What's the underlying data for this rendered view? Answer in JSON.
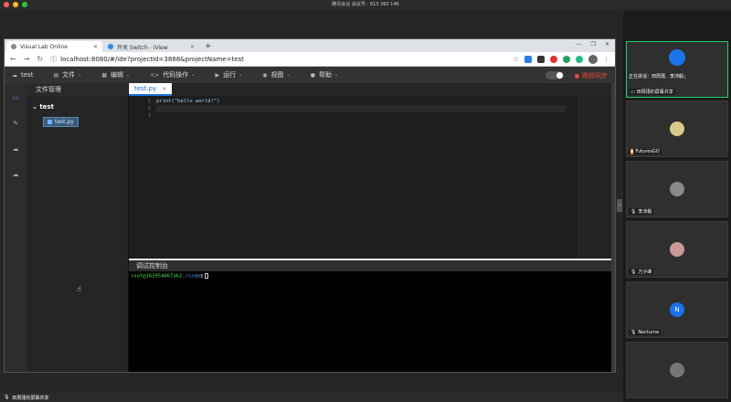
{
  "meeting": {
    "title": "腾讯会议 会议号：813 360 146",
    "screen_share_label": "田周瑾的屏幕共享",
    "speaking_label": "正在讲话：田周瑾、李沛毅；"
  },
  "browser": {
    "tabs": [
      {
        "label": "Visual Lab Online",
        "active": true
      },
      {
        "label": "开关 Switch - iView",
        "active": false
      }
    ],
    "url": "localhost:8080/#/ide?projectId=3888&projectName=test"
  },
  "app": {
    "menu": [
      {
        "label": "test",
        "icon": "cloud-icon"
      },
      {
        "label": "文件",
        "icon": "file-icon"
      },
      {
        "label": "编辑",
        "icon": "edit-icon"
      },
      {
        "label": "代码操作",
        "icon": "code-icon"
      },
      {
        "label": "运行",
        "icon": "play-icon"
      },
      {
        "label": "视图",
        "icon": "view-icon"
      },
      {
        "label": "帮助",
        "icon": "help-icon"
      }
    ],
    "record_status": "跟踪同步",
    "file_panel_title": "文件管理",
    "tree_root": "test",
    "tree_file": "test.py",
    "editor_tab": "test.py",
    "code_lines": [
      "print(\"hello world!\")",
      "",
      ""
    ],
    "line_numbers": [
      "1",
      "2",
      "3"
    ],
    "console_title": "调试控制台",
    "console_user": "root@163954667ab2",
    "console_path": ":/code",
    "console_symbol": "$"
  },
  "participants": [
    {
      "name": "田周瑾的屏幕共享",
      "avatar_color": "#1a73e8",
      "active": true
    },
    {
      "name": "FuturesGO",
      "avatar_color": "#d9c98a",
      "active": false
    },
    {
      "name": "李沛毅",
      "avatar_color": "#8a8a8a",
      "active": false
    },
    {
      "name": "万子峰",
      "avatar_color": "#c99",
      "active": false
    },
    {
      "name": "Nocturne",
      "avatar_color": "#1a73e8",
      "initial": "N",
      "active": false
    },
    {
      "name": "",
      "avatar_color": "#777",
      "active": false
    }
  ]
}
